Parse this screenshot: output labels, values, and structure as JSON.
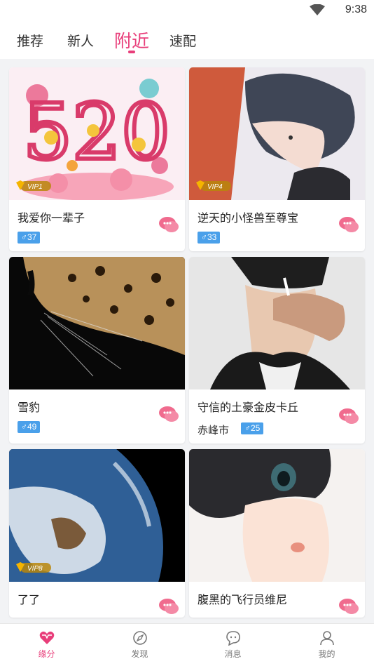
{
  "status": {
    "time": "9:38"
  },
  "tabs": [
    {
      "label": "推荐"
    },
    {
      "label": "新人"
    },
    {
      "label": "附近",
      "active": true
    },
    {
      "label": "速配"
    }
  ],
  "cards": [
    {
      "name": "我爱你一辈子",
      "gender": "♂",
      "age": "37",
      "vip": "VIP1",
      "city": ""
    },
    {
      "name": "逆天的小怪兽至尊宝",
      "gender": "♂",
      "age": "33",
      "vip": "VIP4",
      "city": ""
    },
    {
      "name": "雪豹",
      "gender": "♂",
      "age": "49",
      "vip": "",
      "city": ""
    },
    {
      "name": "守信的土豪金皮卡丘",
      "gender": "♂",
      "age": "25",
      "vip": "",
      "city": "赤峰市"
    },
    {
      "name": "了了",
      "gender": "",
      "age": "",
      "vip": "VIP8",
      "city": ""
    },
    {
      "name": "腹黑的飞行员维尼",
      "gender": "",
      "age": "",
      "vip": "",
      "city": ""
    }
  ],
  "bottom_nav": [
    {
      "label": "缘分",
      "icon": "heart-icon",
      "active": true
    },
    {
      "label": "发现",
      "icon": "compass-icon"
    },
    {
      "label": "消息",
      "icon": "message-icon"
    },
    {
      "label": "我的",
      "icon": "user-icon"
    }
  ],
  "colors": {
    "accent": "#e83e7a",
    "badge": "#4aa0ea",
    "chat": "#f06b8e"
  }
}
